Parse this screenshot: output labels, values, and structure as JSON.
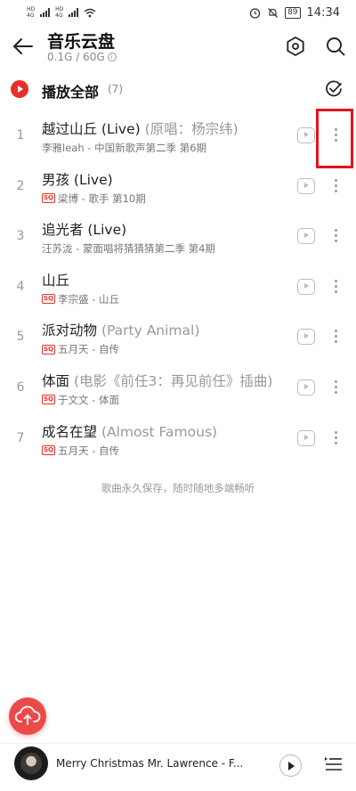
{
  "status_bar": {
    "signal_labels": [
      "HD",
      "HD"
    ],
    "network": [
      "4G",
      "4G"
    ],
    "battery": "89",
    "time": "14:34"
  },
  "header": {
    "title": "音乐云盘",
    "storage": "0.1G / 60G",
    "info_icon_glyph": "i"
  },
  "play_all": {
    "label": "播放全部",
    "count": "(7)"
  },
  "songs": [
    {
      "index": "1",
      "title": "越过山丘 (Live)",
      "subtitle": " (原唱：杨宗纬)",
      "sq": false,
      "meta": "李雅leah - 中国新歌声第二季 第6期"
    },
    {
      "index": "2",
      "title": "男孩 (Live)",
      "subtitle": "",
      "sq": true,
      "meta": "梁博 - 歌手 第10期"
    },
    {
      "index": "3",
      "title": "追光者 (Live)",
      "subtitle": "",
      "sq": false,
      "meta": "汪苏泷 - 蒙面唱将猜猜猜第二季 第4期"
    },
    {
      "index": "4",
      "title": "山丘",
      "subtitle": "",
      "sq": true,
      "meta": "李宗盛 - 山丘"
    },
    {
      "index": "5",
      "title": "派对动物",
      "subtitle": " (Party Animal)",
      "sq": true,
      "meta": "五月天 - 自传"
    },
    {
      "index": "6",
      "title": "体面",
      "subtitle": " (电影《前任3：再见前任》插曲)",
      "sq": true,
      "meta": "于文文 - 体面"
    },
    {
      "index": "7",
      "title": "成名在望",
      "subtitle": " (Almost Famous)",
      "sq": true,
      "meta": "五月天 - 自传"
    }
  ],
  "sq_label": "SQ",
  "footer_note": "歌曲永久保存，随时随地多端畅听",
  "mini_player": {
    "now_playing": "Merry Christmas Mr. Lawrence - F..."
  },
  "colors": {
    "accent": "#e8302a",
    "highlight": "#e3141d"
  }
}
